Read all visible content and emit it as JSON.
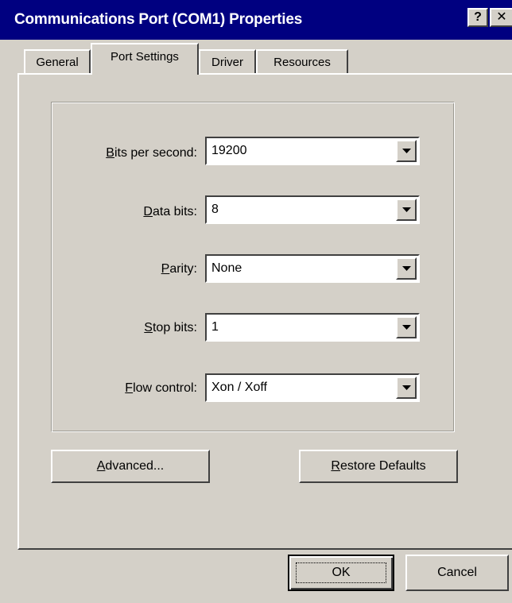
{
  "window": {
    "title": "Communications Port (COM1) Properties",
    "help_label": "?",
    "close_label": "✕"
  },
  "tabs": [
    {
      "label": "General",
      "active": false
    },
    {
      "label": "Port Settings",
      "active": true
    },
    {
      "label": "Driver",
      "active": false
    },
    {
      "label": "Resources",
      "active": false
    }
  ],
  "fields": {
    "bits_per_second": {
      "mnemonic": "B",
      "label_rest": "its per second:",
      "value": "19200"
    },
    "data_bits": {
      "mnemonic": "D",
      "label_rest": "ata bits:",
      "value": "8"
    },
    "parity": {
      "mnemonic_pre": "",
      "mnemonic": "P",
      "label_rest": "arity:",
      "value": "None"
    },
    "stop_bits": {
      "mnemonic": "S",
      "label_rest": "top bits:",
      "value": "1"
    },
    "flow_control": {
      "mnemonic": "F",
      "label_rest": "low control:",
      "value": "Xon / Xoff"
    }
  },
  "buttons": {
    "advanced": {
      "mnemonic": "A",
      "label_rest": "dvanced..."
    },
    "restore": {
      "mnemonic": "R",
      "label_rest": "estore Defaults"
    },
    "ok": "OK",
    "cancel": "Cancel"
  },
  "colors": {
    "title_bar": "#000080",
    "face": "#d4d0c8"
  }
}
